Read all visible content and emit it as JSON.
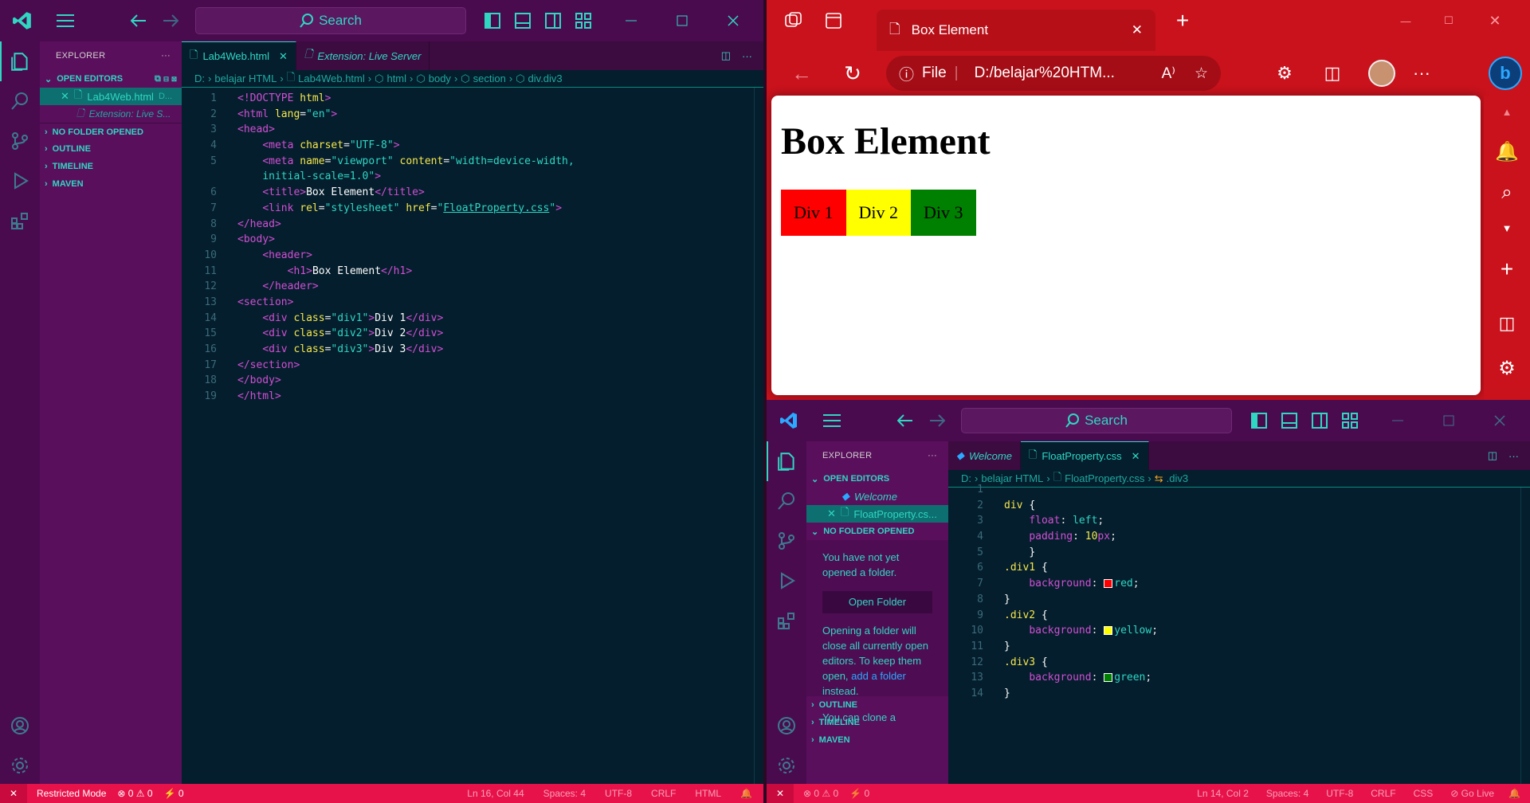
{
  "left_vscode": {
    "search": "Search",
    "explorer_title": "EXPLORER",
    "open_editors": "OPEN EDITORS",
    "open_files": [
      {
        "name": "Lab4Web.html",
        "path": "D..."
      },
      {
        "name": "Extension: Live S...",
        "path": ""
      }
    ],
    "sections": [
      "NO FOLDER OPENED",
      "OUTLINE",
      "TIMELINE",
      "MAVEN"
    ],
    "tabs": [
      "Lab4Web.html",
      "Extension: Live Server"
    ],
    "breadcrumb": [
      "D:",
      "belajar HTML",
      "Lab4Web.html",
      "html",
      "body",
      "section",
      "div.div3"
    ],
    "line_numbers": [
      "1",
      "2",
      "3",
      "4",
      "5",
      "",
      "6",
      "7",
      "8",
      "9",
      "10",
      "11",
      "12",
      "13",
      "14",
      "15",
      "16",
      "17",
      "18",
      "19"
    ],
    "status": {
      "mode": "Restricted Mode",
      "problems": "⊗ 0 ⚠ 0",
      "ports": "⚡ 0",
      "position": "Ln 16, Col 44",
      "spaces": "Spaces: 4",
      "encoding": "UTF-8",
      "eol": "CRLF",
      "language": "HTML"
    }
  },
  "browser": {
    "tab_title": "Box Element",
    "address_file": "File",
    "address_url": "D:/belajar%20HTM...",
    "page_heading": "Box Element",
    "boxes": [
      {
        "label": "Div 1",
        "color": "#ff0000"
      },
      {
        "label": "Div 2",
        "color": "#ffff00"
      },
      {
        "label": "Div 3",
        "color": "#008000"
      }
    ]
  },
  "right_vscode": {
    "search": "Search",
    "explorer_title": "EXPLORER",
    "open_editors": "OPEN EDITORS",
    "open_files": [
      "Welcome",
      "FloatProperty.cs..."
    ],
    "no_folder": "NO FOLDER OPENED",
    "no_folder_msg": "You have not yet opened a folder.",
    "open_folder_btn": "Open Folder",
    "opening_msg_1": "Opening a folder will close all currently open editors. To keep them open,",
    "add_folder_link": "add a folder",
    "opening_msg_2": "instead.",
    "clone_msg": "You can clone a",
    "sections": [
      "OUTLINE",
      "TIMELINE",
      "MAVEN"
    ],
    "tabs": [
      "Welcome",
      "FloatProperty.css"
    ],
    "breadcrumb": [
      "D:",
      "belajar HTML",
      "FloatProperty.css",
      ".div3"
    ],
    "line_numbers": [
      "1",
      "2",
      "3",
      "4",
      "5",
      "6",
      "7",
      "8",
      "9",
      "10",
      "11",
      "12",
      "13",
      "14"
    ],
    "status": {
      "problems": "⊗ 0 ⚠ 0",
      "ports": "⚡ 0",
      "position": "Ln 14, Col 2",
      "spaces": "Spaces: 4",
      "encoding": "UTF-8",
      "eol": "CRLF",
      "language": "CSS",
      "golive": "⊘ Go Live"
    }
  },
  "colors": {
    "accent": "#2fd7c3",
    "title_bar": "#4a0b4e",
    "sidebar": "#5a0f5c",
    "editor_bg": "#041e2d",
    "status_bar": "#e8124a",
    "browser_frame": "#c9121c"
  }
}
